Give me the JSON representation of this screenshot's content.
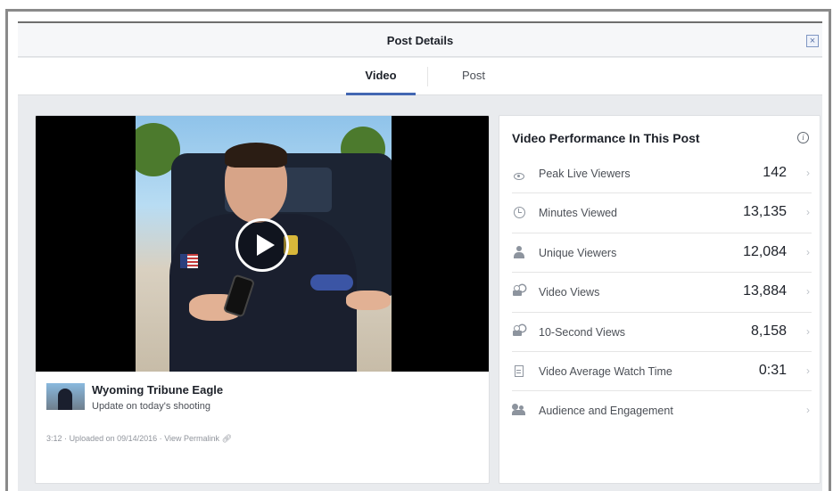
{
  "dialog": {
    "title": "Post Details",
    "close_label": "×"
  },
  "tabs": [
    {
      "label": "Video",
      "active": true
    },
    {
      "label": "Post",
      "active": false
    }
  ],
  "post": {
    "page_name": "Wyoming Tribune Eagle",
    "description": "Update on today's shooting",
    "duration": "3:12",
    "separator": "·",
    "uploaded": "Uploaded on 09/14/2016",
    "permalink": "View Permalink"
  },
  "performance": {
    "title": "Video Performance In This Post",
    "info_glyph": "i",
    "chevron": "›",
    "metrics": [
      {
        "icon": "eye-icon",
        "label": "Peak Live Viewers",
        "value": "142"
      },
      {
        "icon": "clock-icon",
        "label": "Minutes Viewed",
        "value": "13,135"
      },
      {
        "icon": "person-icon",
        "label": "Unique Viewers",
        "value": "12,084"
      },
      {
        "icon": "video-camera-icon",
        "label": "Video Views",
        "value": "13,884"
      },
      {
        "icon": "video-camera-icon",
        "label": "10-Second Views",
        "value": "8,158"
      },
      {
        "icon": "film-icon",
        "label": "Video Average Watch Time",
        "value": "0:31"
      },
      {
        "icon": "group-icon",
        "label": "Audience and Engagement",
        "value": ""
      }
    ]
  },
  "colors": {
    "accent": "#4267b2",
    "dialog_bg": "#e9ebee"
  }
}
